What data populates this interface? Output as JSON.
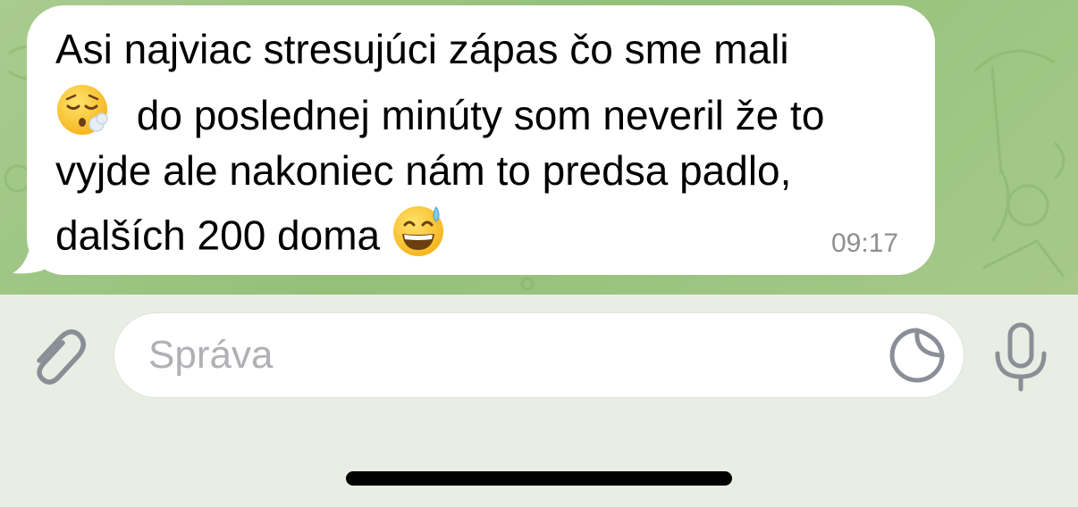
{
  "message": {
    "lines": [
      "Asi najviac stresujúci zápas čo sme mali",
      "do poslednej minúty som neveril že to",
      "vyjde ale nakoniec nám to predsa padlo,",
      "dalších 200 doma"
    ],
    "time": "09:17",
    "emojis": [
      "exhaling-face-emoji",
      "grinning-sweat-emoji"
    ]
  },
  "composer": {
    "placeholder": "Správa",
    "icons": [
      "paperclip-icon",
      "sticker-icon",
      "microphone-icon"
    ]
  },
  "colors": {
    "chat_background": "#9cc482",
    "bubble": "#ffffff",
    "timestamp": "#8e8e93",
    "icon": "#8a8f97",
    "composer_background": "#e8eee3"
  }
}
